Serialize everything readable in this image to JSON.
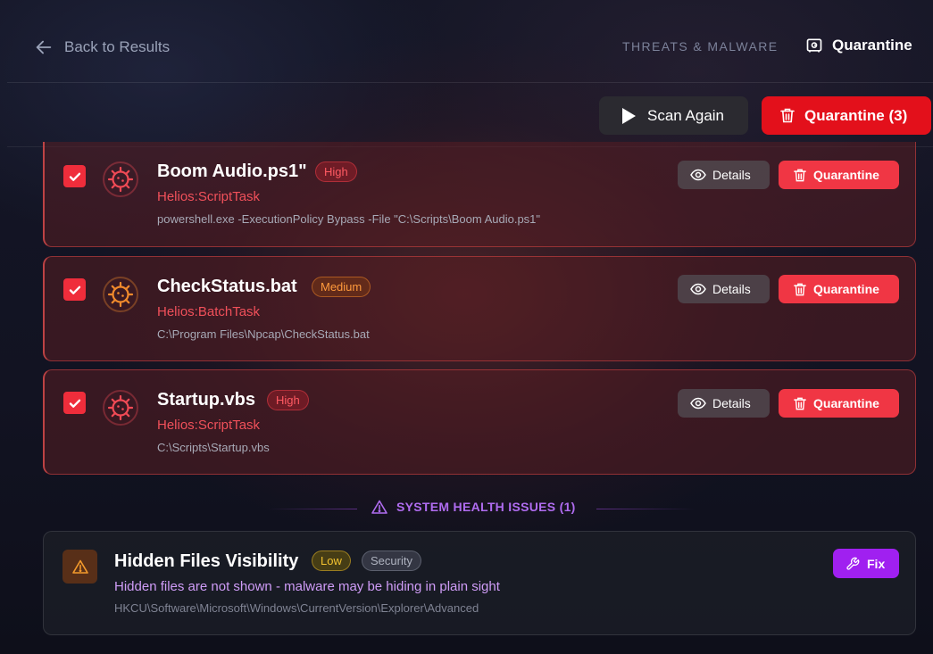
{
  "header": {
    "back_label": "Back to Results",
    "nav_threats": "THREATS & MALWARE",
    "nav_quarantine": "Quarantine"
  },
  "toolbar": {
    "scan_again": "Scan Again",
    "quarantine_all": "Quarantine (3)"
  },
  "threats": [
    {
      "name": "Boom Audio.ps1\"",
      "severity": "High",
      "type": "Helios:ScriptTask",
      "path": "powershell.exe -ExecutionPolicy Bypass -File \"C:\\Scripts\\Boom Audio.ps1\"",
      "checked": true,
      "details_label": "Details",
      "quarantine_label": "Quarantine"
    },
    {
      "name": "CheckStatus.bat",
      "severity": "Medium",
      "type": "Helios:BatchTask",
      "path": "C:\\Program Files\\Npcap\\CheckStatus.bat",
      "checked": true,
      "details_label": "Details",
      "quarantine_label": "Quarantine"
    },
    {
      "name": "Startup.vbs",
      "severity": "High",
      "type": "Helios:ScriptTask",
      "path": "C:\\Scripts\\Startup.vbs",
      "checked": true,
      "details_label": "Details",
      "quarantine_label": "Quarantine"
    }
  ],
  "health_section": {
    "title": "SYSTEM HEALTH ISSUES (1)",
    "issues": [
      {
        "title": "Hidden Files Visibility",
        "severity": "Low",
        "category": "Security",
        "description": "Hidden files are not shown - malware may be hiding in plain sight",
        "path": "HKCU\\Software\\Microsoft\\Windows\\CurrentVersion\\Explorer\\Advanced",
        "fix_label": "Fix"
      }
    ]
  },
  "colors": {
    "accent_red": "#e3101b",
    "high": "#ff5a62",
    "medium": "#ff9a3c",
    "low": "#f2c230",
    "purple": "#a020f0"
  },
  "icons": {
    "back": "arrow-left-icon",
    "quarantine_nav": "vault-icon",
    "scan": "play-icon",
    "quarantine": "trash-icon",
    "details": "eye-icon",
    "threat": "virus-icon",
    "warning": "warning-triangle-icon",
    "fix": "wrench-icon",
    "checkbox": "check-icon"
  }
}
